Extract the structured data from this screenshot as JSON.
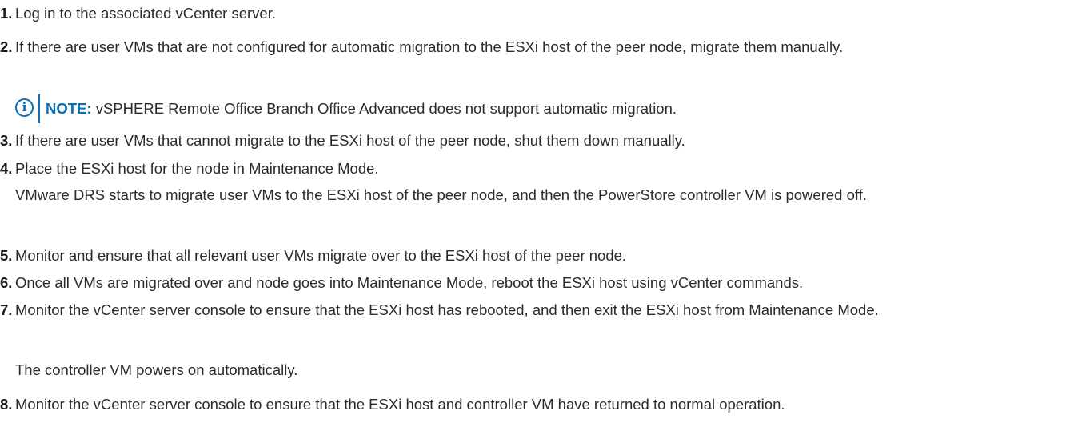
{
  "steps": [
    {
      "num": "1.",
      "text": "Log in to the associated vCenter server."
    },
    {
      "num": "2.",
      "text": "If there are user VMs that are not configured for automatic migration to the ESXi host of the peer node, migrate them manually."
    },
    {
      "num": "3.",
      "text": "If there are user VMs that cannot migrate to the ESXi host of the peer node, shut them down manually."
    },
    {
      "num": "4.",
      "text": "Place the ESXi host for the node in Maintenance Mode.",
      "result": "VMware DRS starts to migrate user VMs to the ESXi host of the peer node, and then the PowerStore controller VM is powered off."
    },
    {
      "num": "5.",
      "text": "Monitor and ensure that all relevant user VMs migrate over to the ESXi host of the peer node."
    },
    {
      "num": "6.",
      "text": "Once all VMs are migrated over and node goes into Maintenance Mode, reboot the ESXi host using vCenter commands."
    },
    {
      "num": "7.",
      "text": "Monitor the vCenter server console to ensure that the ESXi host has rebooted, and then exit the ESXi host from Maintenance Mode.",
      "result": "The controller VM powers on automatically."
    },
    {
      "num": "8.",
      "text": "Monitor the vCenter server console to ensure that the ESXi host and controller VM have returned to normal operation."
    }
  ],
  "note": {
    "icon": "info-icon",
    "icon_glyph": "i",
    "label": "NOTE:",
    "text": " vSPHERE Remote Office Branch Office Advanced does not support automatic migration."
  },
  "colors": {
    "accent": "#0a6fb5",
    "text": "#2b2b2b"
  }
}
